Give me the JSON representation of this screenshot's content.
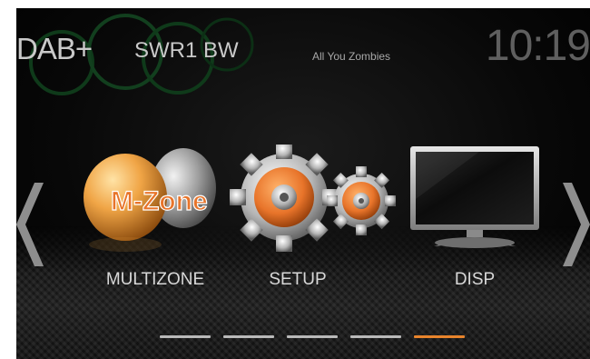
{
  "status": {
    "source": "DAB+",
    "station": "SWR1 BW",
    "track": "All You Zombies",
    "clock": "10:19"
  },
  "menu": {
    "items": [
      {
        "label": "MULTIZONE",
        "icon": "multizone-icon",
        "logo_text": "M-Zone"
      },
      {
        "label": "SETUP",
        "icon": "gears-icon"
      },
      {
        "label": "DISP",
        "icon": "monitor-icon"
      }
    ],
    "pager": {
      "count": 5,
      "active_index": 4
    }
  },
  "colors": {
    "accent": "#e8842c",
    "text": "#d8d8d8",
    "background": "#000000"
  }
}
